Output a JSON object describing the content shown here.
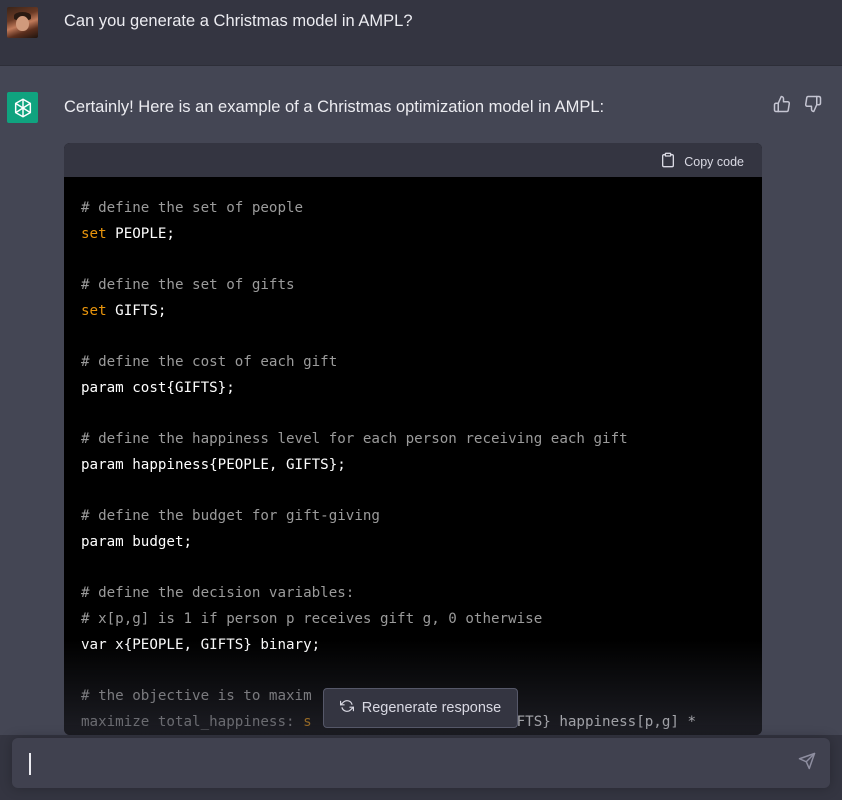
{
  "user": {
    "message": "Can you generate a Christmas model in AMPL?"
  },
  "assistant": {
    "intro": "Certainly! Here is an example of a Christmas optimization model in AMPL:",
    "code_block": {
      "copy_label": "Copy code",
      "lines": [
        {
          "type": "comment",
          "text": "# define the set of people"
        },
        {
          "type": "code",
          "kw": "set",
          "rest": " PEOPLE;"
        },
        {
          "type": "blank",
          "text": ""
        },
        {
          "type": "comment",
          "text": "# define the set of gifts"
        },
        {
          "type": "code",
          "kw": "set",
          "rest": " GIFTS;"
        },
        {
          "type": "blank",
          "text": ""
        },
        {
          "type": "comment",
          "text": "# define the cost of each gift"
        },
        {
          "type": "plain",
          "text": "param cost{GIFTS};"
        },
        {
          "type": "blank",
          "text": ""
        },
        {
          "type": "comment",
          "text": "# define the happiness level for each person receiving each gift"
        },
        {
          "type": "plain",
          "text": "param happiness{PEOPLE, GIFTS};"
        },
        {
          "type": "blank",
          "text": ""
        },
        {
          "type": "comment",
          "text": "# define the budget for gift-giving"
        },
        {
          "type": "plain",
          "text": "param budget;"
        },
        {
          "type": "blank",
          "text": ""
        },
        {
          "type": "comment",
          "text": "# define the decision variables:"
        },
        {
          "type": "comment",
          "text": "# x[p,g] is 1 if person p receives gift g, 0 otherwise"
        },
        {
          "type": "plain",
          "text": "var x{PEOPLE, GIFTS} binary;"
        },
        {
          "type": "blank",
          "text": ""
        },
        {
          "type": "comment",
          "text": "# the objective is to maxim"
        },
        {
          "type": "mixed",
          "pre": "maximize total_happiness: ",
          "kw": "s",
          "post": "                      GIFTS} happiness[p,g] *"
        }
      ]
    }
  },
  "regenerate": {
    "label": "Regenerate response"
  },
  "composer": {
    "value": "",
    "placeholder": ""
  },
  "icons": {
    "thumbs_up": "thumbs-up-icon",
    "thumbs_down": "thumbs-down-icon",
    "copy": "clipboard-icon",
    "regenerate": "refresh-icon",
    "send": "send-icon"
  },
  "colors": {
    "page_bg": "#444654",
    "user_row_bg": "#343541",
    "code_bg": "#000000",
    "code_header_bg": "#343541",
    "comment": "#9b9b9b",
    "keyword": "#e9950c",
    "brand": "#10a37f"
  }
}
